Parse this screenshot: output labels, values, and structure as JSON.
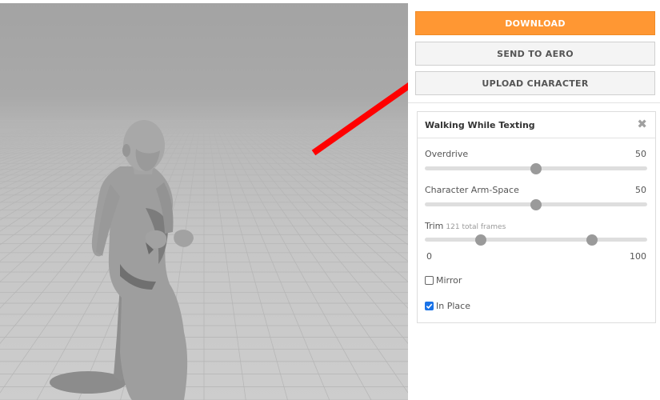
{
  "actions": {
    "download_label": "DOWNLOAD",
    "send_label": "SEND TO AERO",
    "upload_label": "UPLOAD CHARACTER"
  },
  "animation": {
    "title": "Walking While Texting",
    "close_icon": "close-icon",
    "overdrive": {
      "label": "Overdrive",
      "value": "50",
      "level": 50
    },
    "arm_space": {
      "label": "Character Arm-Space",
      "value": "50",
      "level": 50
    },
    "trim": {
      "label": "Trim",
      "frames_note": "121 total frames",
      "min": "0",
      "max": "100",
      "start": 25,
      "end": 75
    },
    "mirror": {
      "label": "Mirror",
      "checked": false
    },
    "in_place": {
      "label": "In Place",
      "checked": true
    }
  },
  "colors": {
    "download_button": "#ff9733",
    "arrow": "#ff0000",
    "checkbox_checked": "#1a73e8"
  }
}
